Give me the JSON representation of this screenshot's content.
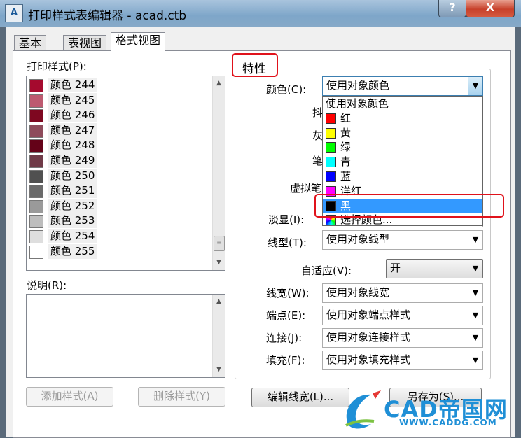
{
  "window": {
    "title": "打印样式表编辑器 - acad.ctb",
    "app_icon_text": "A",
    "help_label": "?",
    "close_label": "X"
  },
  "tabs": [
    {
      "label": "基本"
    },
    {
      "label": "表视图"
    },
    {
      "label": "格式视图",
      "active": true
    }
  ],
  "left": {
    "styles_label": "打印样式(P):",
    "styles": [
      {
        "name": "颜色 244",
        "color": "#a50a2e"
      },
      {
        "name": "颜色 245",
        "color": "#bd5a70"
      },
      {
        "name": "颜色 246",
        "color": "#7e0720"
      },
      {
        "name": "颜色 247",
        "color": "#8e4b5b"
      },
      {
        "name": "颜色 248",
        "color": "#640218"
      },
      {
        "name": "颜色 249",
        "color": "#6f3a47"
      },
      {
        "name": "颜色 250",
        "color": "#505050"
      },
      {
        "name": "颜色 251",
        "color": "#6a6a6a"
      },
      {
        "name": "颜色 252",
        "color": "#9a9a9a"
      },
      {
        "name": "颜色 253",
        "color": "#bdbdbd"
      },
      {
        "name": "颜色 254",
        "color": "#dedede"
      },
      {
        "name": "颜色 255",
        "color": "#ffffff"
      }
    ],
    "description_label": "说明(R):",
    "add_style_button": "添加样式(A)",
    "delete_style_button": "删除样式(Y)"
  },
  "properties": {
    "group_label": "特性",
    "color_label": "颜色(C):",
    "color_value": "使用对象颜色",
    "partial_labels": {
      "dither": "抖",
      "grayscale": "灰",
      "pen": "笔",
      "virtual_pen": "虚拟笔"
    },
    "screening_label": "淡显(I):",
    "linetype_label": "线型(T):",
    "linetype_value": "使用对象线型",
    "adaptive_label": "自适应(V):",
    "adaptive_value": "开",
    "lineweight_label": "线宽(W):",
    "lineweight_value": "使用对象线宽",
    "endstyle_label": "端点(E):",
    "endstyle_value": "使用对象端点样式",
    "joinstyle_label": "连接(J):",
    "joinstyle_value": "使用对象连接样式",
    "fillstyle_label": "填充(F):",
    "fillstyle_value": "使用对象填充样式"
  },
  "color_dropdown": {
    "items": [
      {
        "label": "使用对象颜色",
        "swatch": null
      },
      {
        "label": "红",
        "swatch": "#ff0000"
      },
      {
        "label": "黄",
        "swatch": "#ffff00"
      },
      {
        "label": "绿",
        "swatch": "#00ff00"
      },
      {
        "label": "青",
        "swatch": "#00ffff"
      },
      {
        "label": "蓝",
        "swatch": "#0000ff"
      },
      {
        "label": "洋红",
        "swatch": "#ff00ff"
      },
      {
        "label": "黑",
        "swatch": "#000000",
        "selected": true
      },
      {
        "label": "选择颜色...",
        "swatch": "multicolor"
      }
    ]
  },
  "bottom_buttons": {
    "edit_lineweights": "编辑线宽(L)...",
    "save_as": "另存为(S)..."
  },
  "watermark": {
    "text": "CAD帝国网",
    "url": "WWW.CADDG.COM"
  },
  "colors": {
    "selection": "#3399ff",
    "highlight_box": "#e0121b",
    "title_bar": "#86a9c8",
    "close_button": "#c7402a"
  }
}
